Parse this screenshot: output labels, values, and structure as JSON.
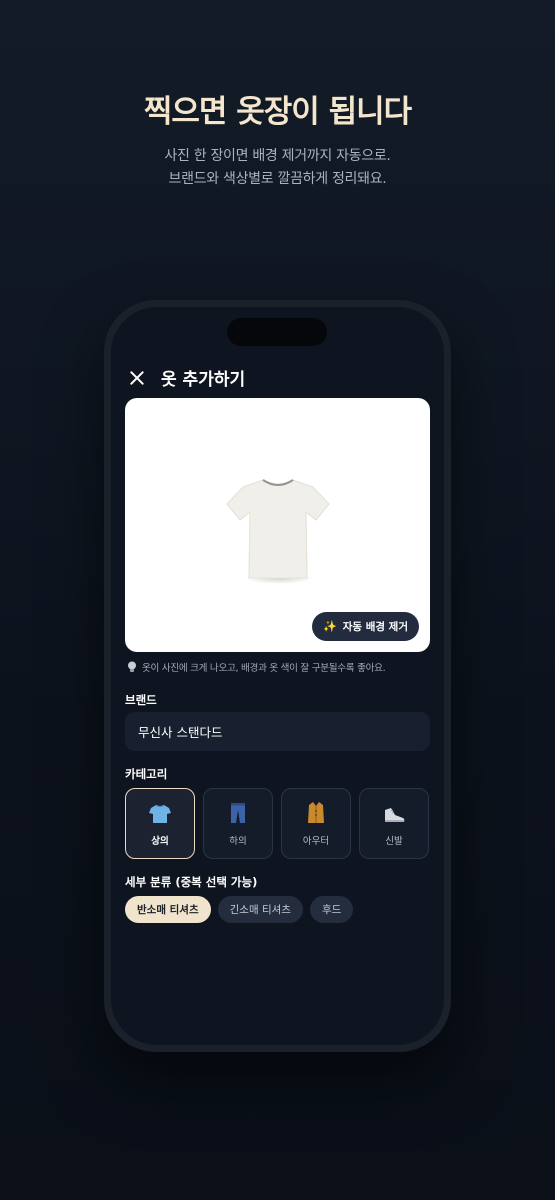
{
  "promo": {
    "headline": "찍으면 옷장이 됩니다",
    "subline_1": "사진 한 장이면 배경 제거까지 자동으로.",
    "subline_2": "브랜드와 색상별로 깔끔하게 정리돼요."
  },
  "screen": {
    "title": "옷 추가하기",
    "photo": {
      "auto_remove_icon": "sparkle-icon",
      "auto_remove_label": "자동 배경 제거"
    },
    "tip": "옷이 사진에 크게 나오고, 배경과 옷 색이 잘 구분될수록 좋아요.",
    "brand": {
      "label": "브랜드",
      "value": "무신사 스탠다드"
    },
    "category": {
      "label": "카테고리",
      "items": [
        {
          "label": "상의",
          "icon": "shirt-icon",
          "selected": true
        },
        {
          "label": "하의",
          "icon": "jeans-icon",
          "selected": false
        },
        {
          "label": "아우터",
          "icon": "coat-icon",
          "selected": false
        },
        {
          "label": "신발",
          "icon": "sneaker-icon",
          "selected": false
        }
      ]
    },
    "detail": {
      "label": "세부 분류 (중복 선택 가능)",
      "chips": [
        {
          "label": "반소매 티셔츠",
          "selected": true
        },
        {
          "label": "긴소매 티셔츠",
          "selected": false
        },
        {
          "label": "후드",
          "selected": false
        }
      ]
    }
  },
  "colors": {
    "accent": "#f1e4cc",
    "background": "#0f1520",
    "card": "#18202f"
  }
}
